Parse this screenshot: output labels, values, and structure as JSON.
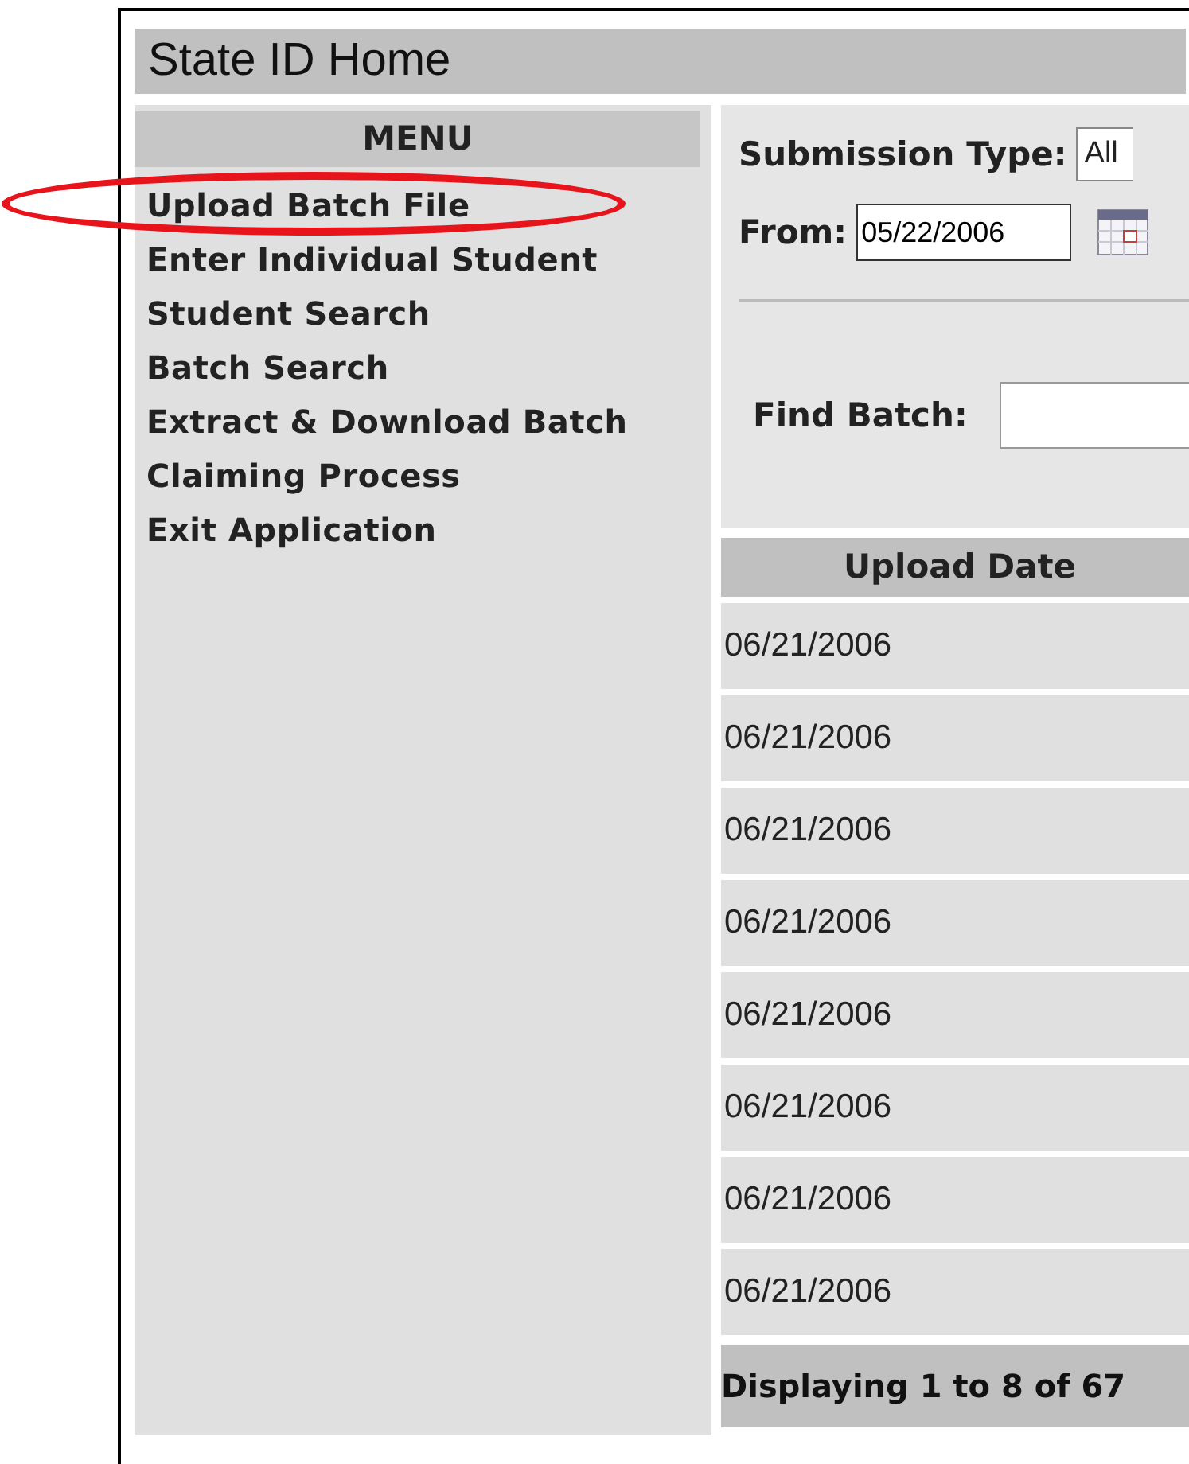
{
  "page_title": "State ID Home",
  "menu": {
    "heading": "MENU",
    "items": [
      {
        "label": "Upload Batch File",
        "circled": true
      },
      {
        "label": "Enter Individual Student",
        "circled": false
      },
      {
        "label": "Student Search",
        "circled": false
      },
      {
        "label": "Batch Search",
        "circled": false
      },
      {
        "label": "Extract & Download Batch",
        "circled": false
      },
      {
        "label": "Claiming Process",
        "circled": false
      },
      {
        "label": "Exit Application",
        "circled": false
      }
    ]
  },
  "filters": {
    "submission_type": {
      "label": "Submission Type:",
      "value": "All"
    },
    "from": {
      "label": "From:",
      "value": "05/22/2006"
    },
    "find_batch": {
      "label": "Find Batch:"
    }
  },
  "table": {
    "columns": [
      "Upload Date"
    ],
    "rows": [
      [
        "06/21/2006"
      ],
      [
        "06/21/2006"
      ],
      [
        "06/21/2006"
      ],
      [
        "06/21/2006"
      ],
      [
        "06/21/2006"
      ],
      [
        "06/21/2006"
      ],
      [
        "06/21/2006"
      ],
      [
        "06/21/2006"
      ]
    ],
    "footer": "Displaying 1 to 8 of 67"
  }
}
